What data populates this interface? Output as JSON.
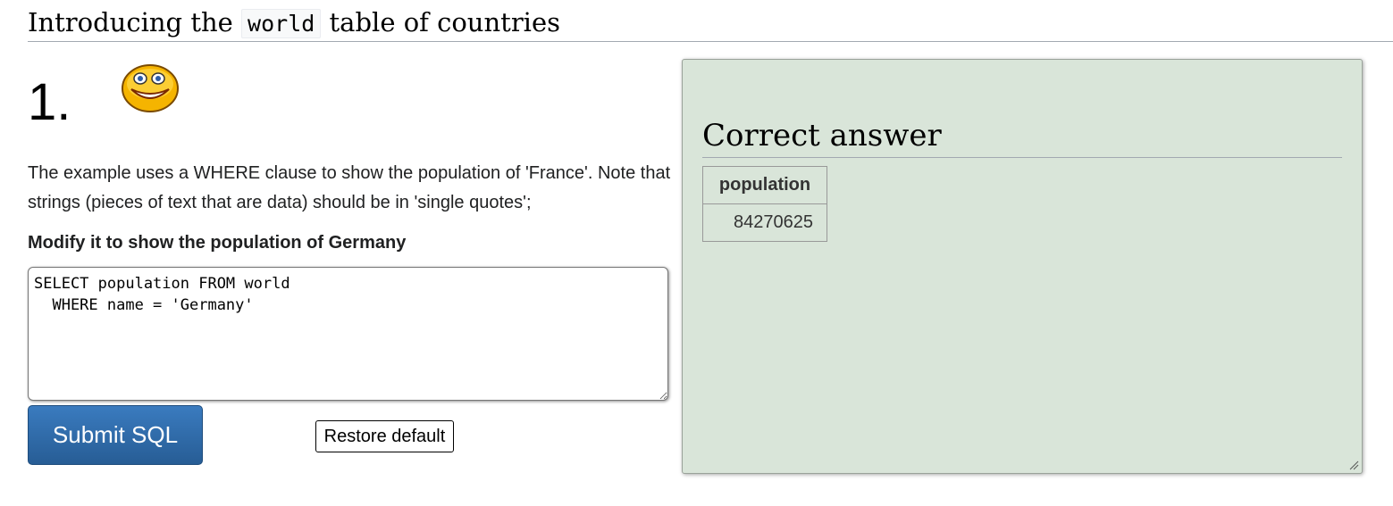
{
  "heading": {
    "before": "Introducing the",
    "code": "world",
    "after": "table of countries"
  },
  "question": {
    "number": "1.",
    "icon": "smiley-face-icon",
    "description": "The example uses a WHERE clause to show the population of 'France'. Note that strings (pieces of text that are data) should be in 'single quotes';",
    "instruction": "Modify it to show the population of Germany"
  },
  "editor": {
    "sql": "SELECT population FROM world\n  WHERE name = 'Germany'"
  },
  "buttons": {
    "submit": "Submit SQL",
    "restore": "Restore default"
  },
  "answer": {
    "title": "Correct answer",
    "columns": [
      "population"
    ],
    "rows": [
      [
        "84270625"
      ]
    ],
    "background_color": "#d9e5d9"
  },
  "colors": {
    "submit_button": "#2f6aa8"
  }
}
